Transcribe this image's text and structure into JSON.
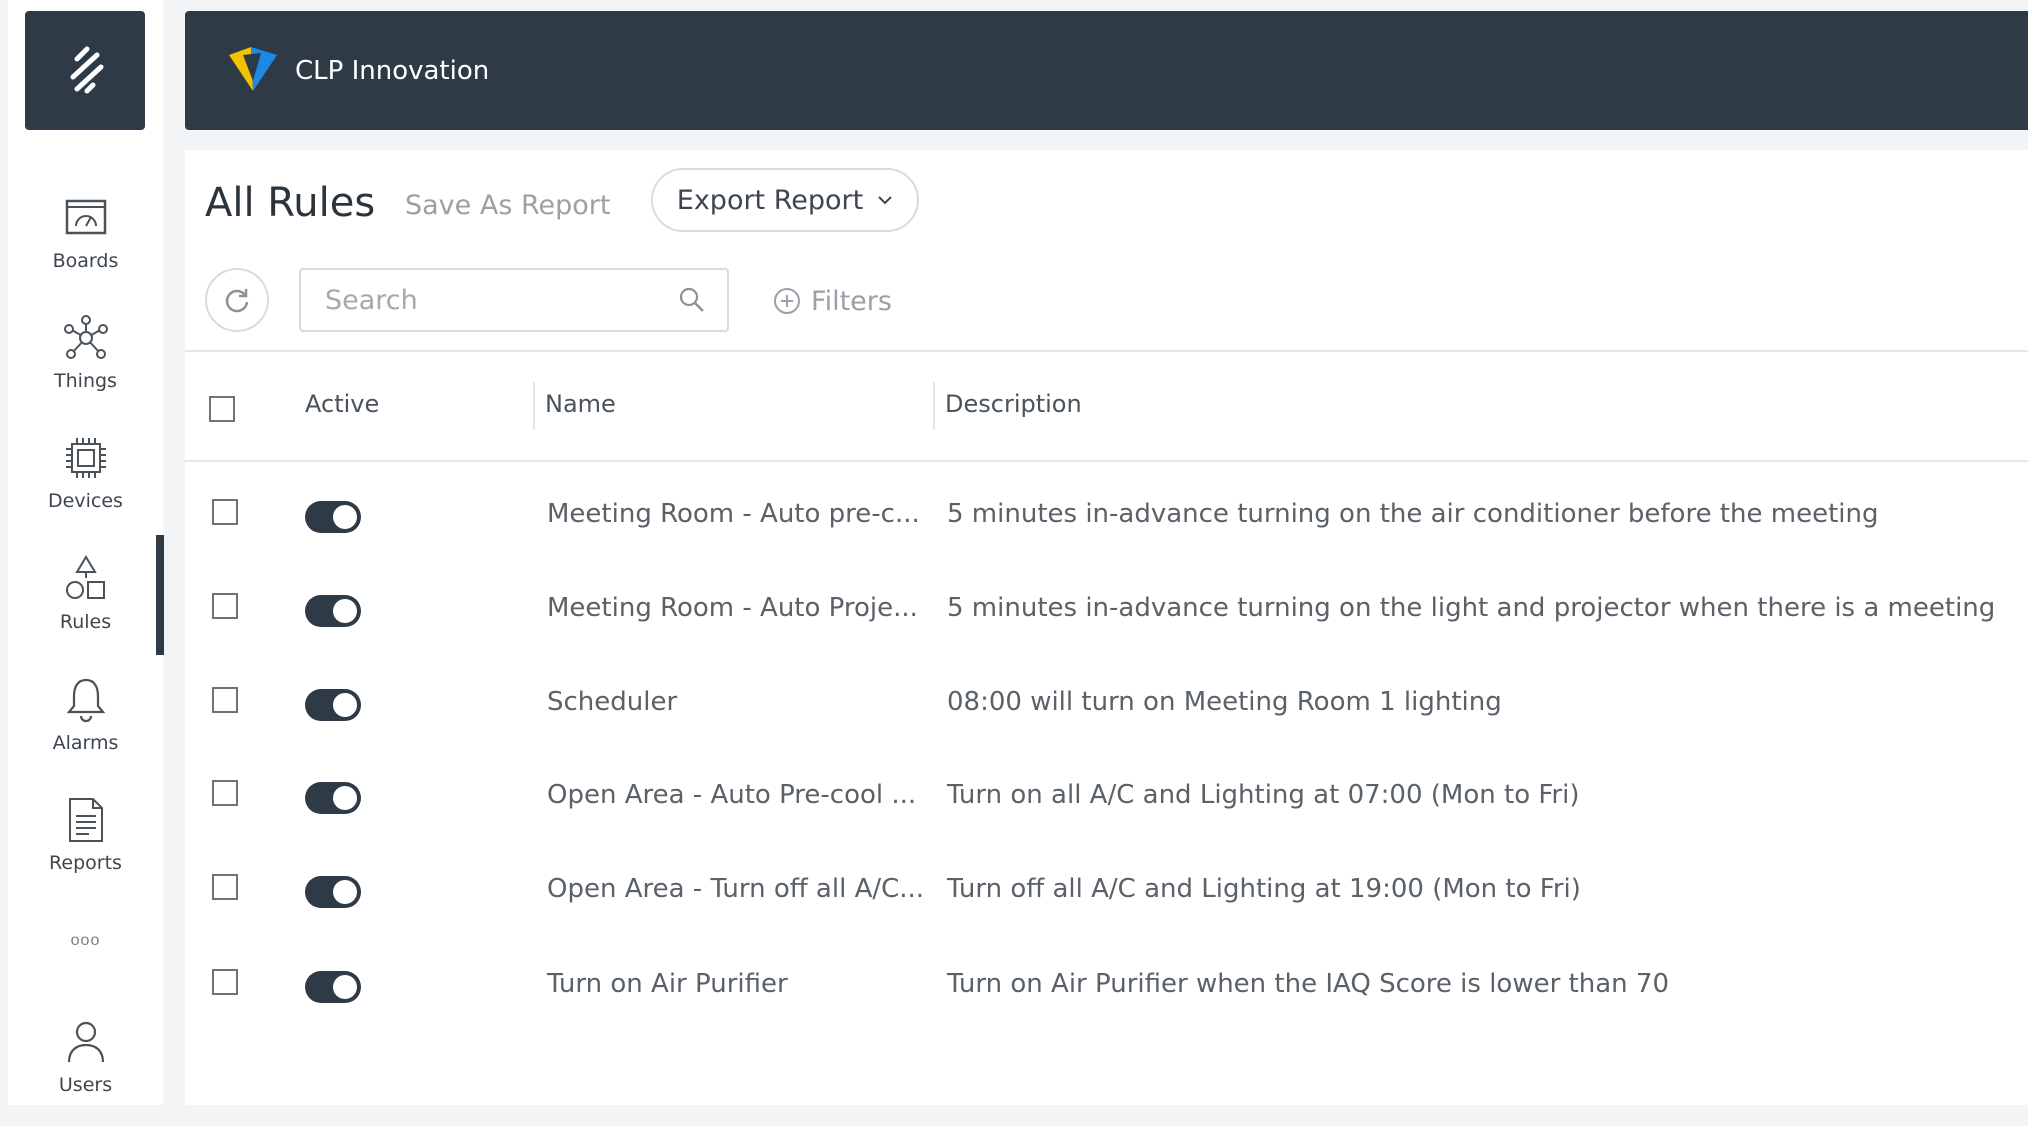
{
  "app": {
    "brand_name": "CLP Innovation",
    "logo_icon": "sparkle-stripes-icon",
    "brand_logo_icon": "clp-shield-logo"
  },
  "sidebar": {
    "items": [
      {
        "label": "Boards",
        "icon": "dashboard-icon"
      },
      {
        "label": "Things",
        "icon": "network-icon"
      },
      {
        "label": "Devices",
        "icon": "chip-icon"
      },
      {
        "label": "Rules",
        "icon": "shapes-icon",
        "active": true
      },
      {
        "label": "Alarms",
        "icon": "bell-icon"
      },
      {
        "label": "Reports",
        "icon": "document-icon"
      },
      {
        "label": "Users",
        "icon": "user-icon"
      }
    ],
    "more_label": "ooo"
  },
  "page": {
    "title": "All Rules",
    "save_as_report": "Save As Report",
    "export_report": "Export Report",
    "search_placeholder": "Search",
    "filters_label": "Filters"
  },
  "table": {
    "columns": [
      "Active",
      "Name",
      "Description"
    ],
    "rows": [
      {
        "active": true,
        "name": "Meeting Room - Auto pre-c...",
        "description": "5 minutes in-advance turning on the air conditioner before the meeting"
      },
      {
        "active": true,
        "name": "Meeting Room - Auto Proje...",
        "description": "5 minutes in-advance turning on the light and projector when there is a meeting"
      },
      {
        "active": true,
        "name": "Scheduler",
        "description": "08:00 will turn on Meeting Room 1 lighting"
      },
      {
        "active": true,
        "name": "Open Area - Auto Pre-cool ...",
        "description": "Turn on all A/C and Lighting at 07:00 (Mon to Fri)"
      },
      {
        "active": true,
        "name": "Open Area - Turn off all A/C...",
        "description": "Turn off all A/C and Lighting at 19:00 (Mon to Fri)"
      },
      {
        "active": true,
        "name": "Turn on Air Purifier",
        "description": "Turn on Air Purifier when the IAQ Score is lower than 70"
      }
    ]
  },
  "colors": {
    "dark": "#2f3a47",
    "background": "#f3f4f6",
    "brand_yellow": "#f2c200",
    "brand_blue": "#1e88e5"
  }
}
